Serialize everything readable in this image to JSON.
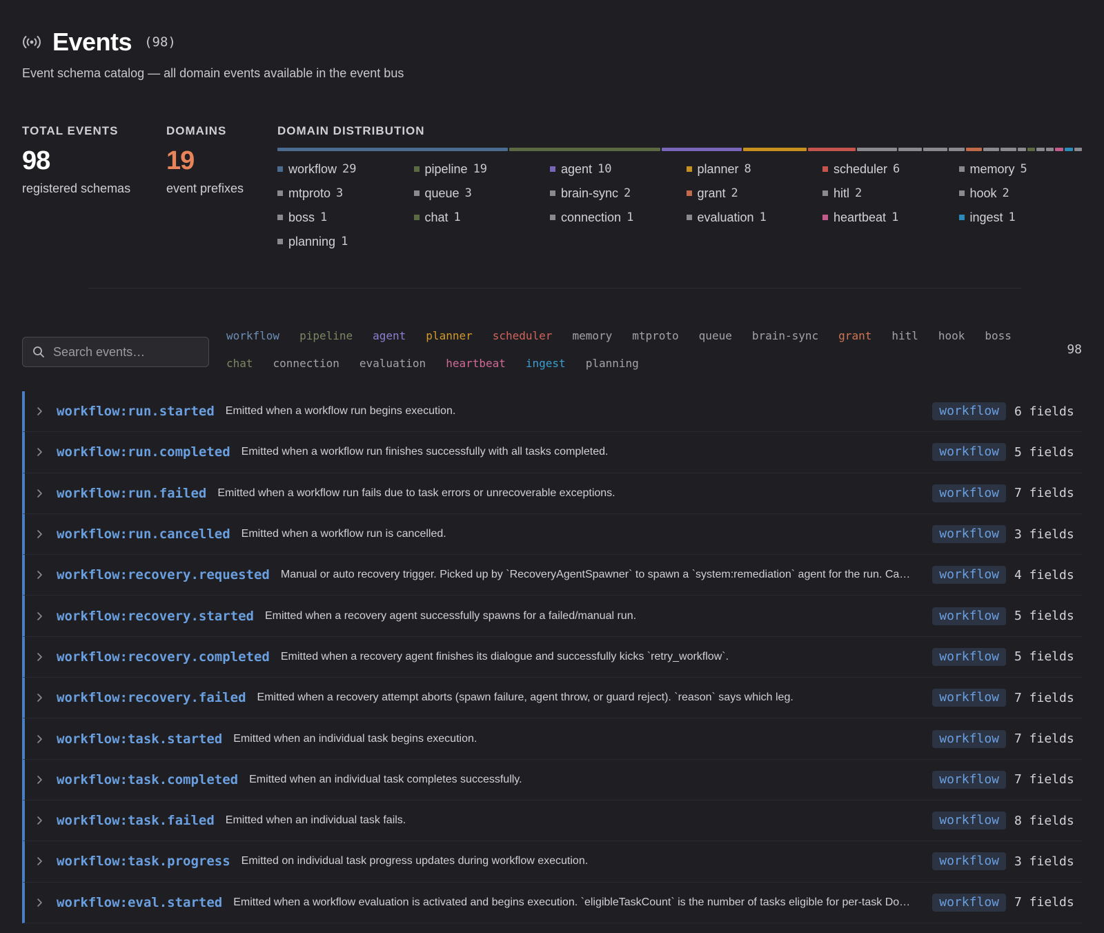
{
  "header": {
    "title": "Events",
    "count": "(98)",
    "subtitle": "Event schema catalog — all domain events available in the event bus",
    "icon": "broadcast-icon"
  },
  "stats": {
    "total_label": "TOTAL EVENTS",
    "total_value": "98",
    "total_caption": "registered schemas",
    "domains_label": "DOMAINS",
    "domains_value": "19",
    "domains_caption": "event prefixes",
    "distribution_label": "DOMAIN DISTRIBUTION"
  },
  "domains": [
    {
      "name": "workflow",
      "count": 29,
      "color": "#4b6b8f"
    },
    {
      "name": "pipeline",
      "count": 19,
      "color": "#5c6a44"
    },
    {
      "name": "agent",
      "count": 10,
      "color": "#7a66b8"
    },
    {
      "name": "planner",
      "count": 8,
      "color": "#c7901e"
    },
    {
      "name": "scheduler",
      "count": 6,
      "color": "#c4544c"
    },
    {
      "name": "memory",
      "count": 5,
      "color": "#8a8a8e"
    },
    {
      "name": "mtproto",
      "count": 3,
      "color": "#8a8a8e"
    },
    {
      "name": "queue",
      "count": 3,
      "color": "#8a8a8e"
    },
    {
      "name": "brain-sync",
      "count": 2,
      "color": "#8a8a8e"
    },
    {
      "name": "grant",
      "count": 2,
      "color": "#c06a4a"
    },
    {
      "name": "hitl",
      "count": 2,
      "color": "#8a8a8e"
    },
    {
      "name": "hook",
      "count": 2,
      "color": "#8a8a8e"
    },
    {
      "name": "boss",
      "count": 1,
      "color": "#8a8a8e"
    },
    {
      "name": "chat",
      "count": 1,
      "color": "#5c6a44"
    },
    {
      "name": "connection",
      "count": 1,
      "color": "#8a8a8e"
    },
    {
      "name": "evaluation",
      "count": 1,
      "color": "#8a8a8e"
    },
    {
      "name": "heartbeat",
      "count": 1,
      "color": "#c25a8a"
    },
    {
      "name": "ingest",
      "count": 1,
      "color": "#2a8ab8"
    },
    {
      "name": "planning",
      "count": 1,
      "color": "#8a8a8e"
    }
  ],
  "filter": {
    "search_placeholder": "Search events…",
    "result_count": "98",
    "chips": [
      {
        "label": "workflow",
        "color": "#6d8fb6"
      },
      {
        "label": "pipeline",
        "color": "#7d8763"
      },
      {
        "label": "agent",
        "color": "#8f7fd0"
      },
      {
        "label": "planner",
        "color": "#d29a2c"
      },
      {
        "label": "scheduler",
        "color": "#d0645c"
      },
      {
        "label": "memory",
        "color": "#a3a3a8"
      },
      {
        "label": "mtproto",
        "color": "#a3a3a8"
      },
      {
        "label": "queue",
        "color": "#a3a3a8"
      },
      {
        "label": "brain-sync",
        "color": "#a3a3a8"
      },
      {
        "label": "grant",
        "color": "#cf7752"
      },
      {
        "label": "hitl",
        "color": "#a3a3a8"
      },
      {
        "label": "hook",
        "color": "#a3a3a8"
      },
      {
        "label": "boss",
        "color": "#a3a3a8"
      },
      {
        "label": "chat",
        "color": "#7d8763"
      },
      {
        "label": "connection",
        "color": "#a3a3a8"
      },
      {
        "label": "evaluation",
        "color": "#a3a3a8"
      },
      {
        "label": "heartbeat",
        "color": "#d06a98"
      },
      {
        "label": "ingest",
        "color": "#3a9ed0"
      },
      {
        "label": "planning",
        "color": "#a3a3a8"
      }
    ]
  },
  "events": [
    {
      "name": "workflow:run.started",
      "desc": "Emitted when a workflow run begins execution.",
      "domain": "workflow",
      "fields": "6 fields"
    },
    {
      "name": "workflow:run.completed",
      "desc": "Emitted when a workflow run finishes successfully with all tasks completed.",
      "domain": "workflow",
      "fields": "5 fields"
    },
    {
      "name": "workflow:run.failed",
      "desc": "Emitted when a workflow run fails due to task errors or unrecoverable exceptions.",
      "domain": "workflow",
      "fields": "7 fields"
    },
    {
      "name": "workflow:run.cancelled",
      "desc": "Emitted when a workflow run is cancelled.",
      "domain": "workflow",
      "fields": "3 fields"
    },
    {
      "name": "workflow:recovery.requested",
      "desc": "Manual or auto recovery trigger. Picked up by `RecoveryAgentSpawner` to spawn a `system:remediation` agent for the run. Ca…",
      "domain": "workflow",
      "fields": "4 fields"
    },
    {
      "name": "workflow:recovery.started",
      "desc": "Emitted when a recovery agent successfully spawns for a failed/manual run.",
      "domain": "workflow",
      "fields": "5 fields"
    },
    {
      "name": "workflow:recovery.completed",
      "desc": "Emitted when a recovery agent finishes its dialogue and successfully kicks `retry_workflow`.",
      "domain": "workflow",
      "fields": "5 fields"
    },
    {
      "name": "workflow:recovery.failed",
      "desc": "Emitted when a recovery attempt aborts (spawn failure, agent throw, or guard reject). `reason` says which leg.",
      "domain": "workflow",
      "fields": "7 fields"
    },
    {
      "name": "workflow:task.started",
      "desc": "Emitted when an individual task begins execution.",
      "domain": "workflow",
      "fields": "7 fields"
    },
    {
      "name": "workflow:task.completed",
      "desc": "Emitted when an individual task completes successfully.",
      "domain": "workflow",
      "fields": "7 fields"
    },
    {
      "name": "workflow:task.failed",
      "desc": "Emitted when an individual task fails.",
      "domain": "workflow",
      "fields": "8 fields"
    },
    {
      "name": "workflow:task.progress",
      "desc": "Emitted on individual task progress updates during workflow execution.",
      "domain": "workflow",
      "fields": "3 fields"
    },
    {
      "name": "workflow:eval.started",
      "desc": "Emitted when a workflow evaluation is activated and begins execution. `eligibleTaskCount` is the number of tasks eligible for per-task Do…",
      "domain": "workflow",
      "fields": "7 fields"
    }
  ]
}
